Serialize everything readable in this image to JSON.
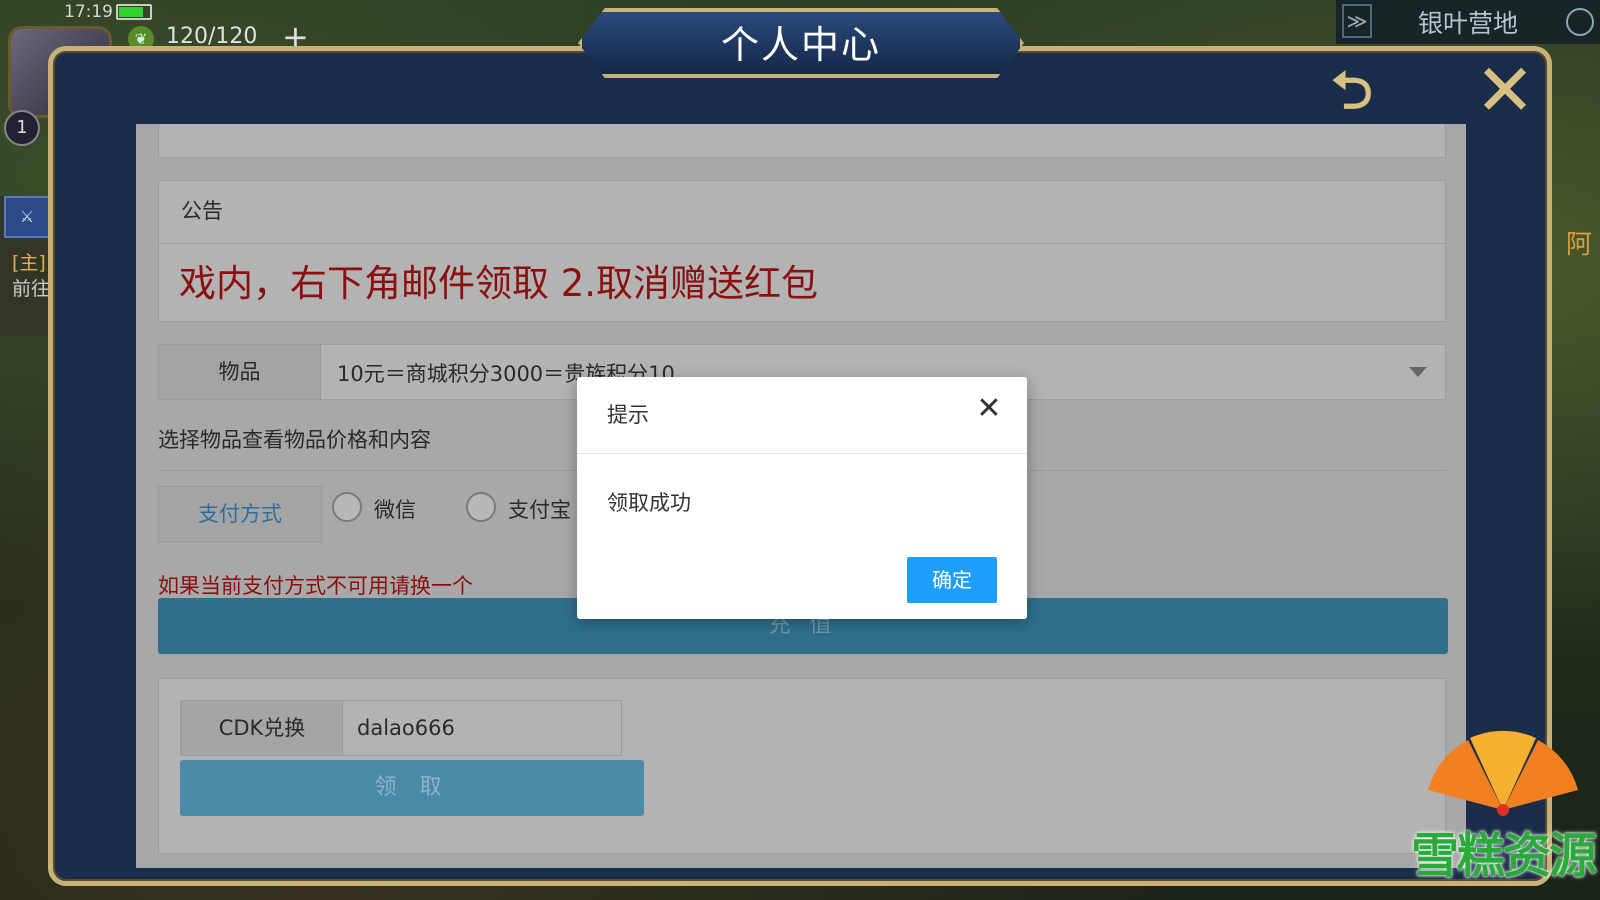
{
  "status_bar": {
    "time": "17:19",
    "battery_level": 0.8,
    "energy": "120/120",
    "energy_plus": "+",
    "player_level": "1"
  },
  "quest": {
    "tag": "[主]",
    "go": "前往"
  },
  "location": {
    "name": "银叶营地",
    "right_name": "阿"
  },
  "panel": {
    "title": "个人中心"
  },
  "notice": {
    "heading": "公告",
    "marquee": "戏内，右下角邮件领取 2.取消赠送红包"
  },
  "item": {
    "label": "物品",
    "value": "10元＝商城积分3000＝贵族积分10",
    "hint": "选择物品查看物品价格和内容"
  },
  "payment": {
    "label": "支付方式",
    "options": [
      "微信",
      "支付宝"
    ],
    "warning": "如果当前支付方式不可用请换一个",
    "recharge_label": "充 值"
  },
  "cdk": {
    "label": "CDK兑换",
    "value": "dalao666",
    "claim_label": "领 取"
  },
  "dialog": {
    "title": "提示",
    "message": "领取成功",
    "ok_label": "确定"
  },
  "watermark": {
    "text": "雪糕资源"
  },
  "colors": {
    "panel_border": "#c9b27a",
    "panel_bg": "#1a2d4a",
    "recharge": "#2f6f8c",
    "dialog_ok": "#1e9fff",
    "warning_red": "#8a1010"
  }
}
